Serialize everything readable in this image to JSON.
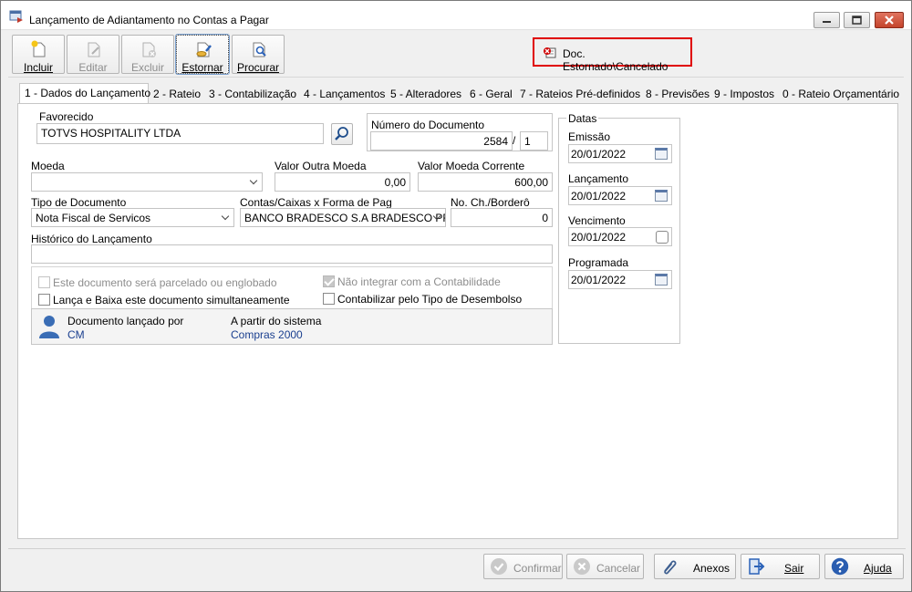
{
  "window": {
    "title": "Lançamento de Adiantamento no Contas a Pagar"
  },
  "toolbar": {
    "incluir": "Incluir",
    "editar": "Editar",
    "excluir": "Excluir",
    "estornar": "Estornar",
    "procurar": "Procurar"
  },
  "status": {
    "label": "Doc. Estornado\\Cancelado",
    "color": "#e00000"
  },
  "tabs": [
    "1 - Dados do Lançamento",
    "2 - Rateio",
    "3 - Contabilização",
    "4 - Lançamentos",
    "5 - Alteradores",
    "6 - Geral",
    "7 - Rateios Pré-definidos",
    "8 - Previsões",
    "9 - Impostos",
    "0 - Rateio Orçamentário"
  ],
  "form": {
    "favorecido_label": "Favorecido",
    "favorecido_value": "TOTVS HOSPITALITY LTDA",
    "numero_documento_label": "Número do Documento",
    "numero_documento_value": "2584",
    "numero_separator": "/",
    "parcela_value": "1",
    "moeda_label": "Moeda",
    "moeda_value": "",
    "valor_outra_moeda_label": "Valor Outra Moeda",
    "valor_outra_moeda_value": "0,00",
    "valor_moeda_corrente_label": "Valor Moeda Corrente",
    "valor_moeda_corrente_value": "600,00",
    "tipo_documento_label": "Tipo de Documento",
    "tipo_documento_value": "Nota Fiscal de Servicos",
    "contas_caixas_label": "Contas/Caixas x Forma de Pag",
    "contas_caixas_value": "BANCO BRADESCO S.A BRADESCO PRIM",
    "no_ch_bordero_label": "No. Ch./Borderô",
    "no_ch_bordero_value": "0",
    "historico_label": "Histórico do Lançamento",
    "historico_value": ""
  },
  "checkboxes": {
    "parcelado": "Este documento será parcelado ou englobado",
    "nao_integrar": "Não integrar com a Contabilidade",
    "lanca_baixa": "Lança e Baixa este documento simultaneamente",
    "contabilizar": "Contabilizar pelo Tipo de Desembolso"
  },
  "info": {
    "lancado_por_label": "Documento lançado por",
    "lancado_por_value": "CM",
    "sistema_label": "A partir do sistema",
    "sistema_value": "Compras 2000"
  },
  "datas": {
    "title": "Datas",
    "emissao_label": "Emissão",
    "emissao_value": "20/01/2022",
    "lancamento_label": "Lançamento",
    "lancamento_value": "20/01/2022",
    "vencimento_label": "Vencimento",
    "vencimento_value": "20/01/2022",
    "programada_label": "Programada",
    "programada_value": "20/01/2022"
  },
  "buttons": {
    "confirmar": "Confirmar",
    "cancelar": "Cancelar",
    "anexos": "Anexos",
    "sair": "Sair",
    "ajuda": "Ajuda"
  }
}
